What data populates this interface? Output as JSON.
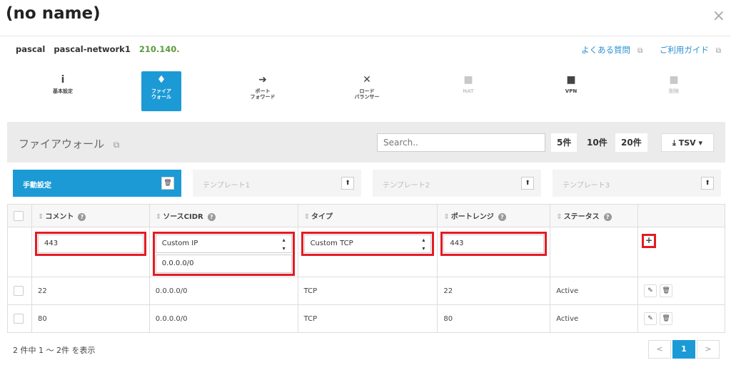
{
  "modal": {
    "title": "(no name)",
    "close": "×"
  },
  "server": {
    "name": "pascal",
    "network": "pascal-network1",
    "ip": "210.140."
  },
  "help": {
    "faq": "よくある質問",
    "guide": "ご利用ガイド"
  },
  "menu": [
    {
      "icon": "i",
      "label": "基本設定"
    },
    {
      "icon": "♦",
      "label": "ファイア\nウォール"
    },
    {
      "icon": "➜",
      "label": "ポート\nフォワード"
    },
    {
      "icon": "✕",
      "label": "ロード\nバランサー"
    },
    {
      "icon": "■",
      "label": "NAT"
    },
    {
      "icon": "■",
      "label": "VPN"
    },
    {
      "icon": "■",
      "label": "削除"
    }
  ],
  "firewall": {
    "title": "ファイアウォール",
    "search_placeholder": "Search..",
    "page_sizes": [
      "5件",
      "10件",
      "20件"
    ],
    "tsv": "TSV"
  },
  "templates": [
    {
      "label": "手動設定",
      "btn": "🗑"
    },
    {
      "label": "テンプレート1",
      "btn": "⬆"
    },
    {
      "label": "テンプレート2",
      "btn": "⬆"
    },
    {
      "label": "テンプレート3",
      "btn": "⬆"
    }
  ],
  "table": {
    "headers": [
      "コメント",
      "ソースCIDR",
      "タイプ",
      "ポートレンジ",
      "ステータス"
    ],
    "edit_row": {
      "comment": "443",
      "source_cidr_select": "Custom IP",
      "source_cidr_value": "0.0.0.0/0",
      "type_select": "Custom TCP",
      "port_range": "443",
      "add": "+"
    },
    "rows": [
      {
        "comment": "22",
        "source_cidr": "0.0.0.0/0",
        "type": "TCP",
        "port_range": "22",
        "status": "Active"
      },
      {
        "comment": "80",
        "source_cidr": "0.0.0.0/0",
        "type": "TCP",
        "port_range": "80",
        "status": "Active"
      }
    ]
  },
  "footer": {
    "count_text": "2 件中 1 〜 2件 を表示",
    "pages": [
      "<",
      "1",
      ">"
    ]
  }
}
